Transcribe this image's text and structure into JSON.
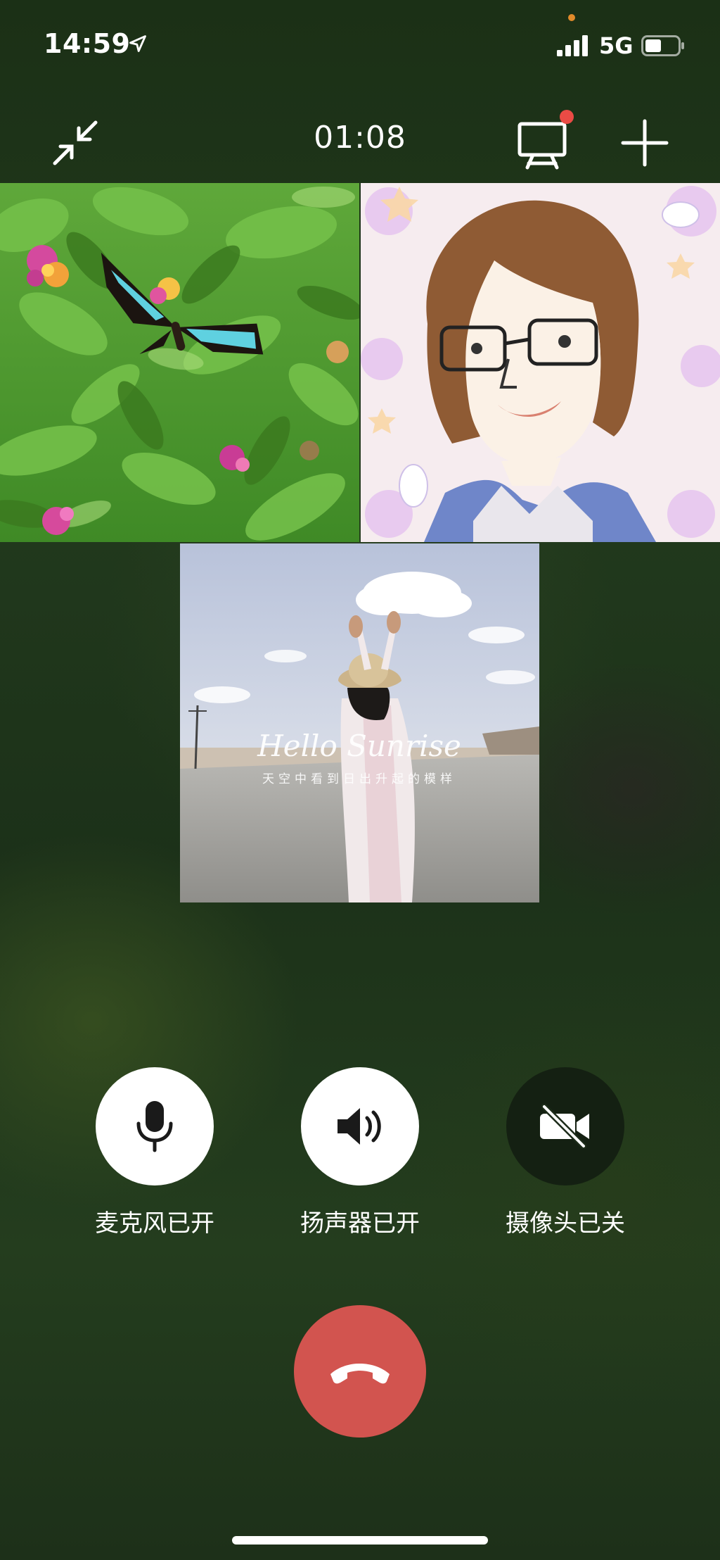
{
  "status_bar": {
    "time": "14:59",
    "network": "5G"
  },
  "call": {
    "timer": "01:08"
  },
  "video_tiles": [
    {
      "subject": "butterfly-on-flowers"
    },
    {
      "subject": "drawn-avatar-portrait"
    },
    {
      "subject": "woman-on-road-photo",
      "overlay_title": "Hello Sunrise",
      "overlay_subtitle": "天空中看到日出升起的模样"
    }
  ],
  "controls": {
    "mic_label": "麦克风已开",
    "speaker_label": "扬声器已开",
    "camera_label": "摄像头已关"
  },
  "colors": {
    "hangup": "#d2544f",
    "notification": "#ea4b45",
    "background": "#1f351a"
  }
}
